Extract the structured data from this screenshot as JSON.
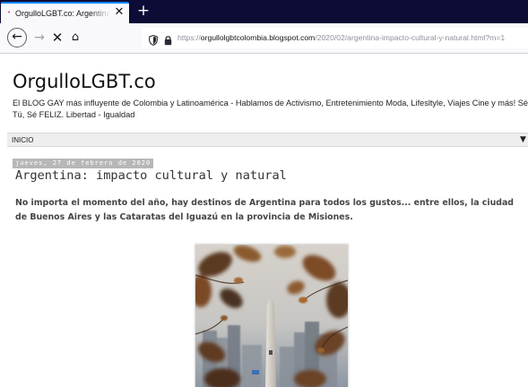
{
  "browser": {
    "tab": {
      "title": "OrgulloLGBT.co: Argentina: impacto cultural y natural",
      "close_glyph": "✕",
      "favicon_glyph": "•"
    },
    "new_tab_glyph": "+",
    "nav": {
      "back_glyph": "←",
      "forward_glyph": "→",
      "stop_glyph": "✕",
      "home_glyph": "⌂"
    },
    "url": {
      "scheme": "https://",
      "host": "orgullolgbtcolombia.blogspot.com",
      "path": "/2020/02/argentina-impacto-cultural-y-natural.html?m=1"
    }
  },
  "blog": {
    "title": "OrgulloLGBT.co",
    "description": "El BLOG GAY más influyente de Colombia y Latinoamérica - Hablamos de Activismo, Entretenimiento Moda, Lifesltyle, Viajes Cine y más! Sé Tú, Sé FELIZ. Libertad - Igualdad"
  },
  "menu": {
    "item": "INICIO",
    "dropdown_glyph": "▼"
  },
  "post": {
    "date": "jueves, 27 de febrero de 2020",
    "title": "Argentina: impacto cultural y natural",
    "summary": "No importa el momento del año, hay destinos de Argentina para todos los gustos... entre ellos, la ciudad de Buenos Aires y las Cataratas del Iguazú en la provincia de Misiones."
  },
  "colors": {
    "tabstrip": "#0c0c36",
    "tab_accent": "#0a84ff",
    "toolbar": "#f9f9fb",
    "date_badge": "#b7b7b7",
    "menubar": "#eeeeee"
  },
  "icons": {
    "shield": "tracking-protection-shield-icon",
    "lock": "padlock-icon"
  }
}
